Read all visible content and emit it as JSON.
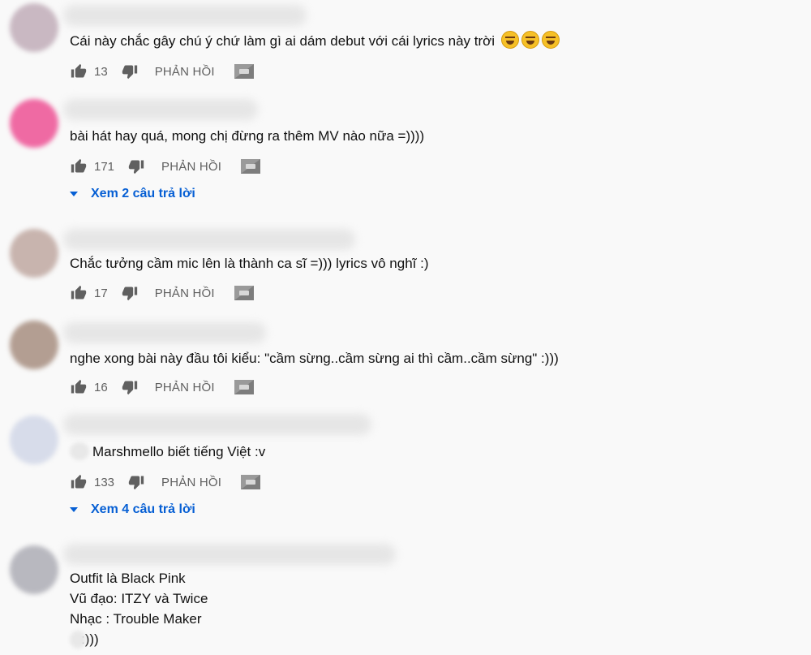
{
  "comments": [
    {
      "text": "Cái này chắc gây chú ý chứ làm gì ai dám debut với cái lyrics này trời",
      "likes": "13",
      "reply_label": "PHẢN HỒI",
      "avatar_color": "#c9b8c2"
    },
    {
      "text": "bài hát hay quá, mong chị đừng ra thêm MV nào nữa =))))",
      "likes": "171",
      "reply_label": "PHẢN HỒI",
      "view_replies": "Xem 2 câu trả lời",
      "avatar_color": "#ef6aa3"
    },
    {
      "text": "Chắc tưởng cầm mic lên là thành ca sĩ =))) lyrics vô nghĩ :)",
      "likes": "17",
      "reply_label": "PHẢN HỒI",
      "avatar_color": "#c8b4ae"
    },
    {
      "text": "nghe xong bài này đầu tôi kiểu: \"cầm sừng..cầm sừng ai thì cầm..cầm sừng\" :)))",
      "likes": "16",
      "reply_label": "PHẢN HỒI",
      "avatar_color": "#b39e92"
    },
    {
      "text": "Marshmello biết tiếng Việt :v",
      "likes": "133",
      "reply_label": "PHẢN HỒI",
      "view_replies": "Xem 4 câu trả lời",
      "avatar_color": "#d7dcea"
    },
    {
      "lines": [
        "Outfit là Black Pink",
        "Vũ đạo: ITZY và Twice",
        "Nhạc : Trouble Maker",
        ":)))"
      ],
      "avatar_color": "#b8b8bf"
    }
  ],
  "colors": {
    "link": "#065fd4",
    "icon": "#606060",
    "background": "#f9f9f9"
  },
  "icons": [
    "thumbs-up-icon",
    "thumbs-down-icon",
    "ext-badge-icon",
    "caret-down-icon",
    "rofl-emoji"
  ]
}
